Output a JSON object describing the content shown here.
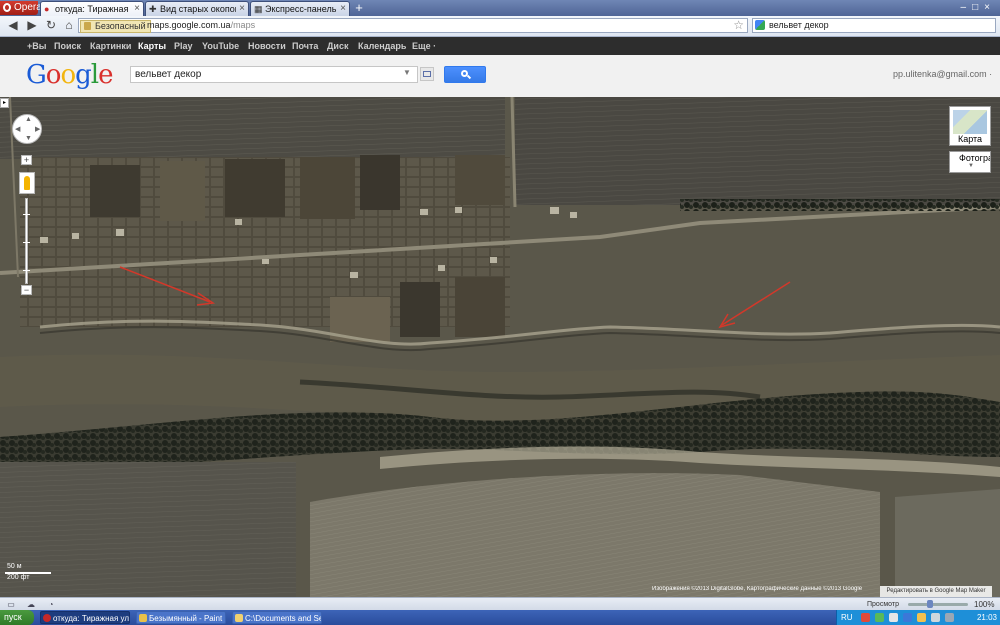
{
  "browser": {
    "opera_label": "Opera",
    "tabs": [
      {
        "title": "откуда: Тиражная ул.; ...",
        "active": true
      },
      {
        "title": "Вид старых окопов со с...",
        "active": false
      },
      {
        "title": "Экспресс-панель",
        "active": false
      }
    ],
    "address": {
      "secure_label": "Безопасный",
      "url_domain": "maps.google.com.ua",
      "url_path": "/maps"
    },
    "search_text": "вельвет декор"
  },
  "gbar": {
    "items": [
      "+Вы",
      "Поиск",
      "Картинки",
      "Карты",
      "Play",
      "YouTube",
      "Новости",
      "Почта",
      "Диск",
      "Календарь",
      "Еще ·"
    ],
    "selected": "Карты"
  },
  "header": {
    "logo_letters": [
      "G",
      "o",
      "o",
      "g",
      "l",
      "e"
    ],
    "logo_colors": [
      "#1a5bd6",
      "#d9302c",
      "#f2b50f",
      "#1a5bd6",
      "#2a9a3a",
      "#d9302c"
    ],
    "query": "вельвет декор",
    "account": "pp.ulitenka@gmail.com ·"
  },
  "map": {
    "type_button_label": "Карта",
    "satellite_label": "Фотогра",
    "scale_top": "50 м",
    "scale_bottom": "200 фт",
    "attribution": "Изображения ©2013 DigitalGlobe, Картографические данные ©2013 Google",
    "mapmaker_link": "Редактировать в Google Map Maker"
  },
  "statusbar": {
    "zoom_label": "Просмотр",
    "zoom_percent": "100%",
    "zoom_level": 0.37
  },
  "taskbar": {
    "start_label": "пуск",
    "items": [
      {
        "label": "откуда: Тиражная ул...",
        "active": true
      },
      {
        "label": "Безымянный - Paint",
        "active": false
      },
      {
        "label": "C:\\Documents and Set...",
        "active": false
      }
    ],
    "lang": "RU",
    "clock": "21:03"
  },
  "colors": {
    "accent_blue": "#4d90fe",
    "google_bar": "#2d2d2d",
    "annotation_arrow": "#d2382a"
  }
}
